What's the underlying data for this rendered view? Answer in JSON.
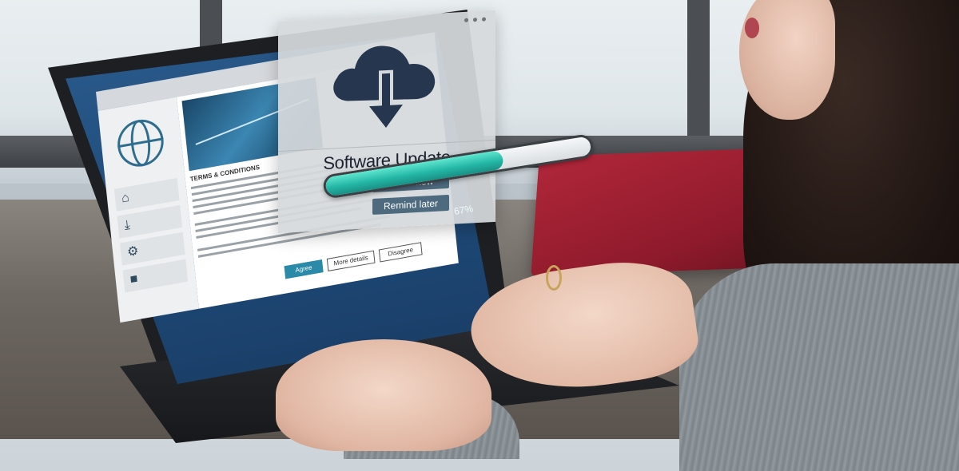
{
  "dialog": {
    "title": "Software Update",
    "install_label": "Install now",
    "remind_label": "Remind later",
    "icon": "cloud-download-icon"
  },
  "progress": {
    "label": "67%",
    "value": 0.67
  },
  "browser": {
    "sidebar_icons": [
      "home-icon",
      "download-icon",
      "gear-icon",
      "folder-icon"
    ],
    "terms_title": "TERMS & CONDITIONS",
    "buttons": {
      "agree": "Agree",
      "more": "More details",
      "disagree": "Disagree"
    }
  },
  "colors": {
    "accent": "#24b7a6",
    "dialog_button": "#4e6a7f",
    "dialog_bg": "#d6d9dc"
  }
}
